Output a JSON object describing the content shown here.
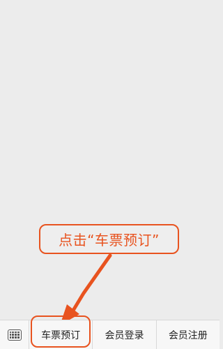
{
  "annotation": {
    "text": "点击“车票预订”",
    "color": "#e8531f"
  },
  "menu_bar": {
    "keyboard_icon": "keyboard-icon",
    "items": [
      {
        "label": "车票预订",
        "highlighted": true
      },
      {
        "label": "会员登录",
        "highlighted": false
      },
      {
        "label": "会员注册",
        "highlighted": false
      }
    ]
  }
}
